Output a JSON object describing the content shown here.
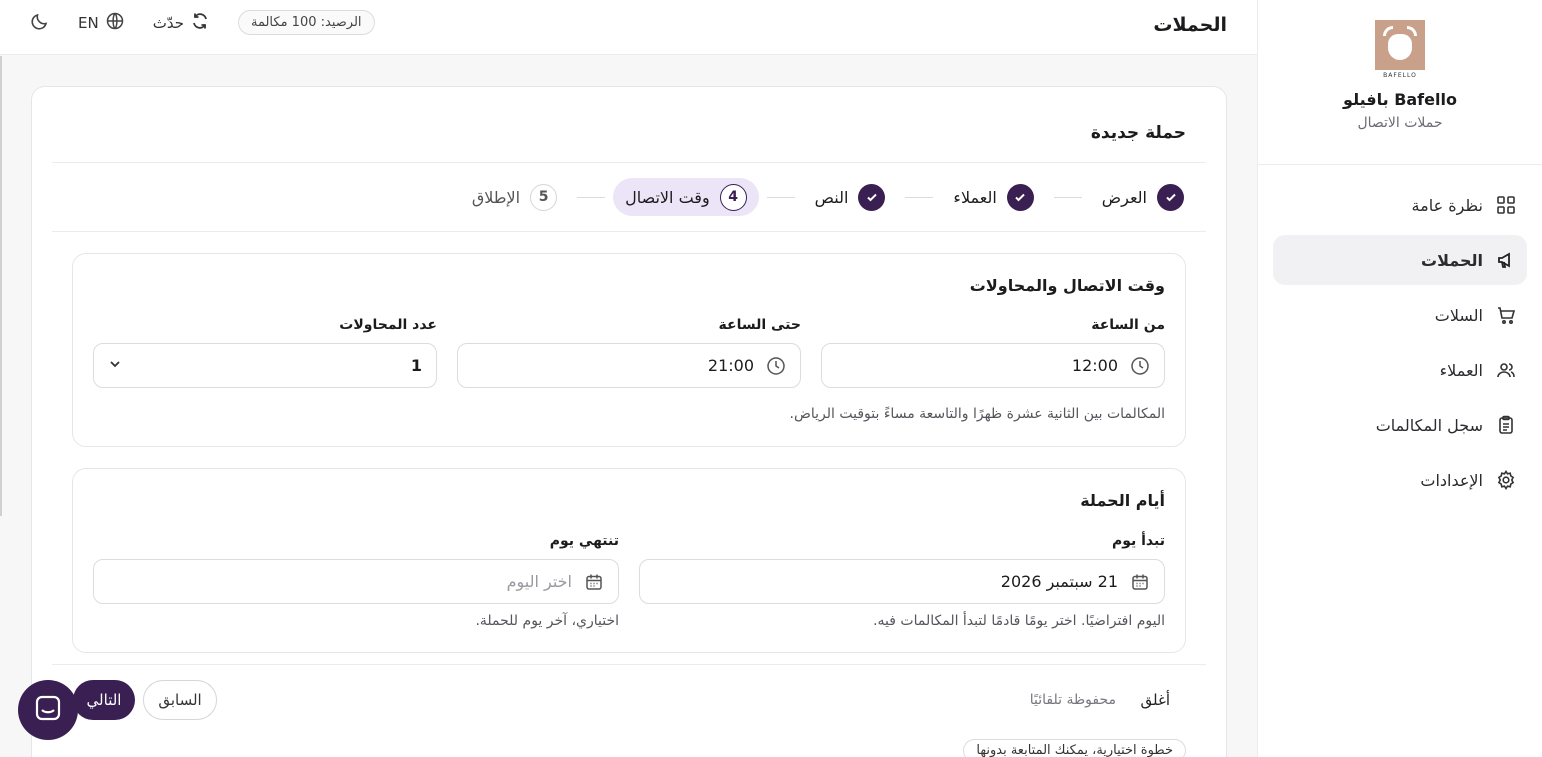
{
  "header": {
    "title": "الحملات",
    "balance": "الرصيد: 100 مكالمة",
    "refresh_label": "حدّث",
    "lang_label": "EN"
  },
  "brand": {
    "logo_text": "BAFELLO",
    "name": "Bafello بافيلو",
    "subtitle": "حملات الاتصال"
  },
  "sidebar": {
    "items": [
      {
        "label": "نظرة عامة",
        "icon": "grid-icon"
      },
      {
        "label": "الحملات",
        "icon": "megaphone-icon",
        "active": true
      },
      {
        "label": "السلات",
        "icon": "cart-icon"
      },
      {
        "label": "العملاء",
        "icon": "users-icon"
      },
      {
        "label": "سجل المكالمات",
        "icon": "clipboard-icon"
      },
      {
        "label": "الإعدادات",
        "icon": "gear-icon"
      }
    ]
  },
  "wizard": {
    "title": "حملة جديدة",
    "steps": [
      {
        "label": "العرض",
        "state": "done"
      },
      {
        "label": "العملاء",
        "state": "done"
      },
      {
        "label": "النص",
        "state": "done"
      },
      {
        "label": "وقت الاتصال",
        "num": "4",
        "state": "active"
      },
      {
        "label": "الإطلاق",
        "num": "5",
        "state": "pending"
      }
    ]
  },
  "call_time": {
    "title": "وقت الاتصال والمحاولات",
    "from_label": "من الساعة",
    "from_value": "12:00",
    "to_label": "حتى الساعة",
    "to_value": "21:00",
    "attempts_label": "عدد المحاولات",
    "attempts_value": "1",
    "help": "المكالمات بين الثانية عشرة ظهرًا والتاسعة مساءً بتوقيت الرياض."
  },
  "campaign_days": {
    "title": "أيام الحملة",
    "start_label": "تبدأ يوم",
    "start_value": "21 سبتمبر 2026",
    "start_help": "اليوم افتراضيًا. اختر يومًا قادمًا لتبدأ المكالمات فيه.",
    "end_label": "تنتهي يوم",
    "end_placeholder": "اختر اليوم",
    "end_help": "اختياري، آخر يوم للحملة."
  },
  "footer": {
    "close": "أغلق",
    "autosave": "محفوظة تلقائيًا",
    "prev": "السابق",
    "next": "التالي",
    "optional_note": "خطوة اختيارية، يمكنك المتابعة بدونها"
  },
  "colors": {
    "accent": "#3a1f52",
    "accent_light": "#ece4f7"
  }
}
